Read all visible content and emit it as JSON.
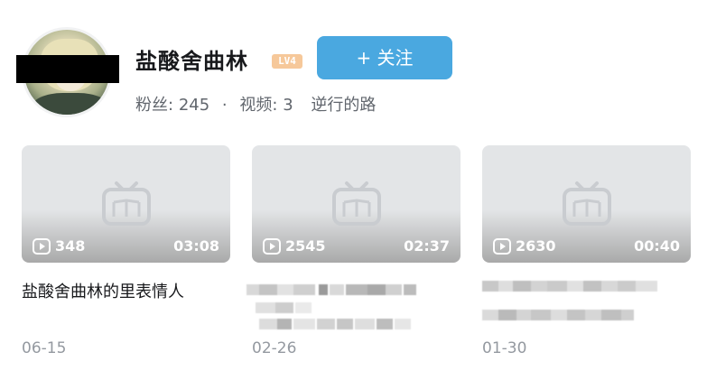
{
  "profile": {
    "username": "盐酸舍曲林",
    "level_badge": "LV4",
    "follow_label": "+ 关注",
    "fans_label": "粉丝:",
    "fans_count": "245",
    "separator": "·",
    "videos_label": "视频:",
    "videos_count": "3",
    "signature": "逆行的路"
  },
  "videos": [
    {
      "plays": "348",
      "duration": "03:08",
      "title": "盐酸舍曲林的里表情人",
      "date": "06-15",
      "title_blurred": false
    },
    {
      "plays": "2545",
      "duration": "02:37",
      "title": "",
      "date": "02-26",
      "title_blurred": true
    },
    {
      "plays": "2630",
      "duration": "00:40",
      "title": "",
      "date": "01-30",
      "title_blurred": true
    }
  ],
  "colors": {
    "follow_button": "#4aa8e0",
    "level_badge": "#f6c89a",
    "muted_text": "#9499a0"
  },
  "icons": {
    "play": "play-count-icon",
    "placeholder": "tv-placeholder-icon"
  }
}
